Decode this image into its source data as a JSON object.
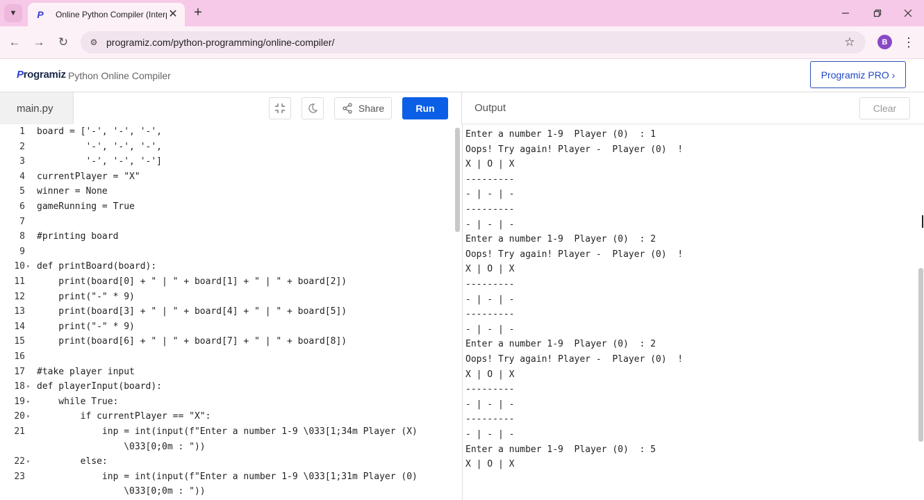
{
  "browser": {
    "tab_title": "Online Python Compiler (Interp",
    "url": "programiz.com/python-programming/online-compiler/",
    "profile_initial": "B"
  },
  "site": {
    "logo_text": "rogramiz",
    "logo_p": "P",
    "title": "Python Online Compiler",
    "pro_button": "Programiz PRO ›"
  },
  "editor": {
    "file_name": "main.py",
    "share_label": "Share",
    "run_label": "Run",
    "lines": [
      {
        "n": "1",
        "fold": "",
        "text": "board = ['-', '-', '-',"
      },
      {
        "n": "2",
        "fold": "",
        "text": "         '-', '-', '-',"
      },
      {
        "n": "3",
        "fold": "",
        "text": "         '-', '-', '-']"
      },
      {
        "n": "4",
        "fold": "",
        "text": "currentPlayer = \"X\""
      },
      {
        "n": "5",
        "fold": "",
        "text": "winner = None"
      },
      {
        "n": "6",
        "fold": "",
        "text": "gameRunning = True"
      },
      {
        "n": "7",
        "fold": "",
        "text": ""
      },
      {
        "n": "8",
        "fold": "",
        "text": "#printing board"
      },
      {
        "n": "9",
        "fold": "",
        "text": ""
      },
      {
        "n": "10",
        "fold": "▾",
        "text": "def printBoard(board):"
      },
      {
        "n": "11",
        "fold": "",
        "text": "    print(board[0] + \" | \" + board[1] + \" | \" + board[2])"
      },
      {
        "n": "12",
        "fold": "",
        "text": "    print(\"-\" * 9)"
      },
      {
        "n": "13",
        "fold": "",
        "text": "    print(board[3] + \" | \" + board[4] + \" | \" + board[5])"
      },
      {
        "n": "14",
        "fold": "",
        "text": "    print(\"-\" * 9)"
      },
      {
        "n": "15",
        "fold": "",
        "text": "    print(board[6] + \" | \" + board[7] + \" | \" + board[8])"
      },
      {
        "n": "16",
        "fold": "",
        "text": ""
      },
      {
        "n": "17",
        "fold": "",
        "text": "#take player input"
      },
      {
        "n": "18",
        "fold": "▾",
        "text": "def playerInput(board):"
      },
      {
        "n": "19",
        "fold": "▾",
        "text": "    while True:"
      },
      {
        "n": "20",
        "fold": "▾",
        "text": "        if currentPlayer == \"X\":"
      },
      {
        "n": "21",
        "fold": "",
        "text": "            inp = int(input(f\"Enter a number 1-9 \\033[1;34m Player (X)"
      },
      {
        "n": "",
        "fold": "",
        "text": "                \\033[0;0m : \"))"
      },
      {
        "n": "22",
        "fold": "▾",
        "text": "        else:"
      },
      {
        "n": "23",
        "fold": "",
        "text": "            inp = int(input(f\"Enter a number 1-9 \\033[1;31m Player (0)"
      },
      {
        "n": "",
        "fold": "",
        "text": "                \\033[0;0m : \"))"
      }
    ]
  },
  "output": {
    "label": "Output",
    "clear_label": "Clear",
    "lines": [
      "Enter a number 1-9  Player (0)  : 1",
      "Oops! Try again! Player -  Player (0)  !",
      "X | O | X",
      "---------",
      "- | - | -",
      "---------",
      "- | - | -",
      "Enter a number 1-9  Player (0)  : 2",
      "Oops! Try again! Player -  Player (0)  !",
      "X | O | X",
      "---------",
      "- | - | -",
      "---------",
      "- | - | -",
      "Enter a number 1-9  Player (0)  : 2",
      "Oops! Try again! Player -  Player (0)  !",
      "X | O | X",
      "---------",
      "- | - | -",
      "---------",
      "- | - | -",
      "Enter a number 1-9  Player (0)  : 5",
      "X | O | X"
    ]
  }
}
